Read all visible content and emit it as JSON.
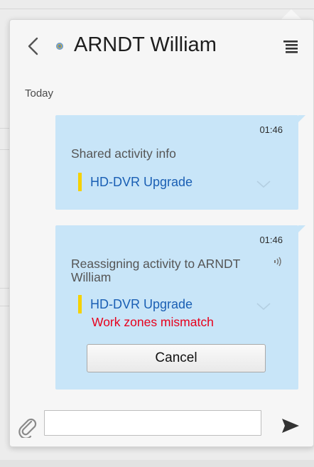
{
  "header": {
    "title": "ARNDT William",
    "back_icon": "chevron-left-icon",
    "menu_icon": "menu-icon",
    "status_color": "#f2b500"
  },
  "conversation": {
    "day_label": "Today",
    "messages": [
      {
        "time": "01:46",
        "text": "Shared activity info",
        "activity": "HD-DVR Upgrade",
        "activity_marker_color": "#f5d100"
      },
      {
        "time": "01:46",
        "text": "Reassigning activity to ARNDT William",
        "activity": "HD-DVR Upgrade",
        "activity_marker_color": "#f5d100",
        "warning": "Work zones mismatch",
        "warning_color": "#e8001c",
        "action_label": "Cancel"
      }
    ]
  },
  "composer": {
    "value": "",
    "placeholder": "",
    "attach_icon": "paperclip-icon",
    "send_icon": "send-icon"
  },
  "colors": {
    "bubble": "#c8e5f8",
    "link": "#1a5fb4"
  }
}
